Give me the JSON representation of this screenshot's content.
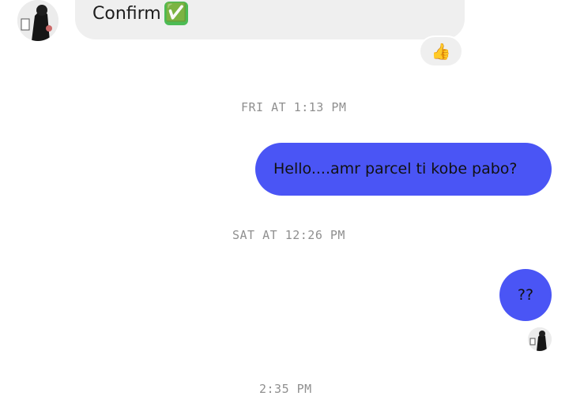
{
  "messages": {
    "incoming_text": "Confirm",
    "incoming_emoji": "✅",
    "reaction": "👍",
    "outgoing_text": "Hello....amr parcel ti kobe pabo?",
    "outgoing_question": "??"
  },
  "timestamps": {
    "first": "FRI AT 1:13 PM",
    "second": "SAT AT 12:26 PM",
    "third": "2:35 PM"
  },
  "icons": {
    "contact_avatar": "avatar-icon",
    "seen_avatar": "avatar-icon",
    "confirm_check": "check-mark-icon",
    "reaction": "thumbs-up-icon"
  },
  "colors": {
    "outgoing_bubble": "#4a55f5",
    "incoming_bubble": "#efefef",
    "timestamp": "#8f8f8f"
  }
}
